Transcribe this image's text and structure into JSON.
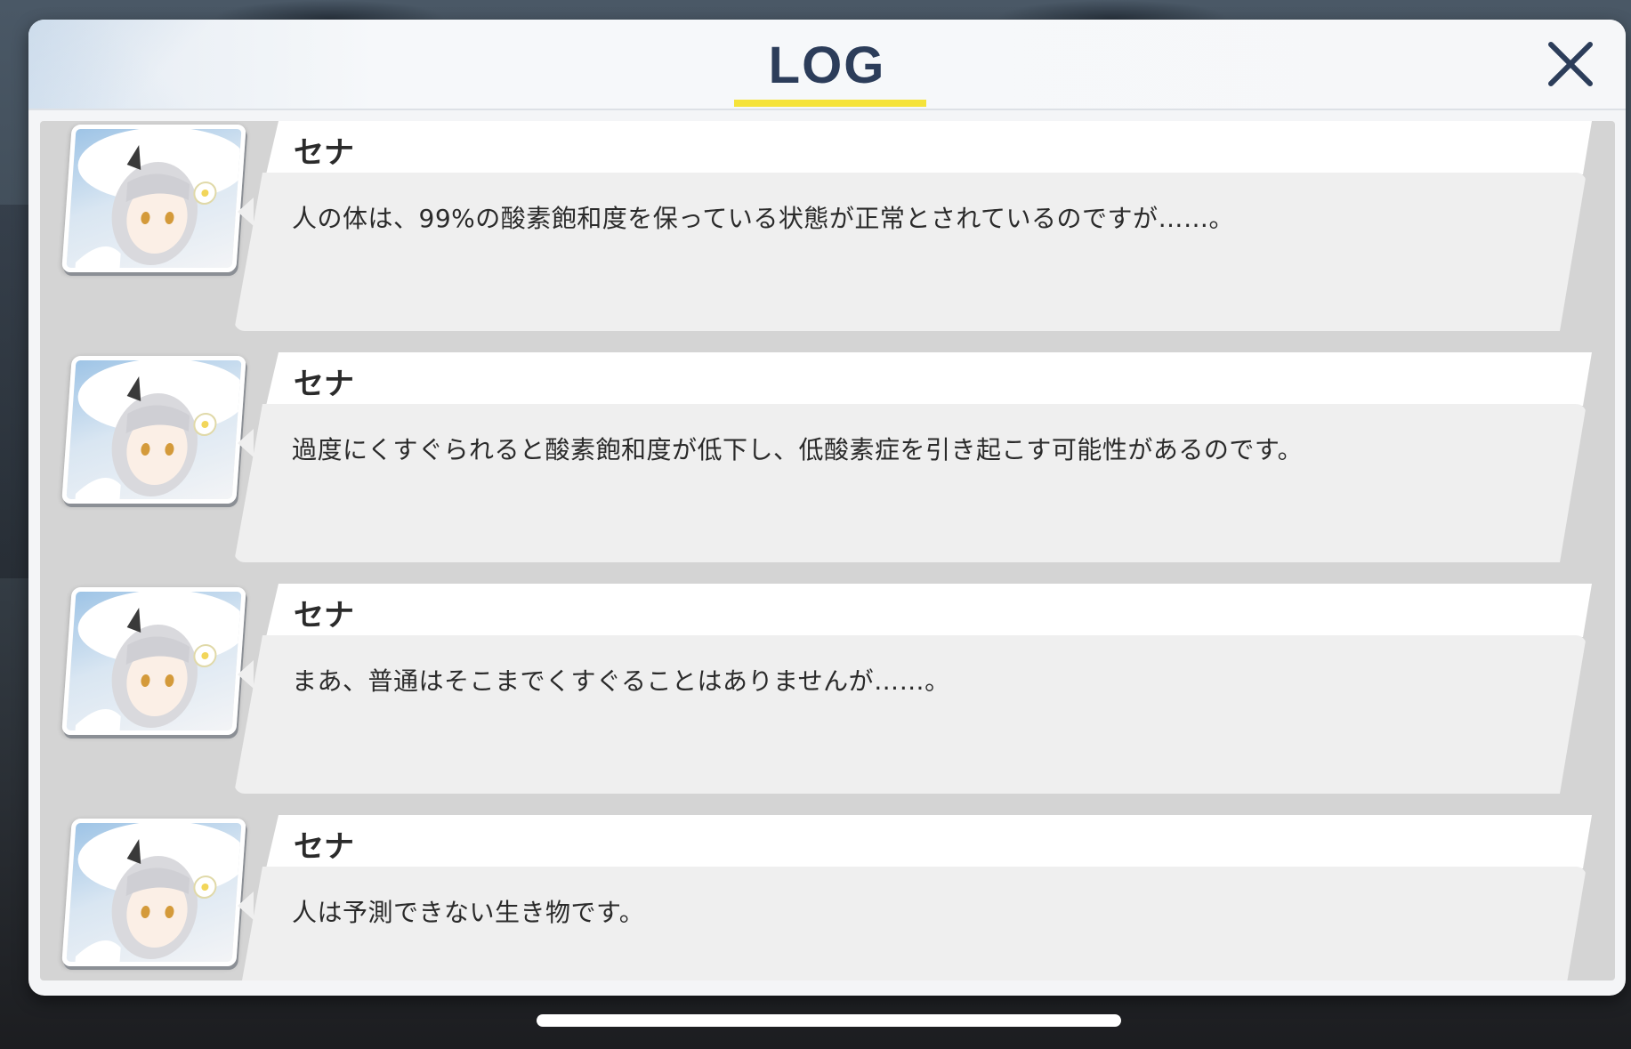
{
  "header": {
    "title": "LOG",
    "close_icon": "close-icon",
    "accent_color": "#f5e33a",
    "title_color": "#2c3d5a"
  },
  "entries": [
    {
      "speaker": "セナ",
      "message": "人の体は、99%の酸素飽和度を保っている状態が正常とされているのですが……。",
      "avatar_icon": "character-portrait"
    },
    {
      "speaker": "セナ",
      "message": "過度にくすぐられると酸素飽和度が低下し、低酸素症を引き起こす可能性があるのです。",
      "avatar_icon": "character-portrait"
    },
    {
      "speaker": "セナ",
      "message": "まあ、普通はそこまでくすぐることはありませんが……。",
      "avatar_icon": "character-portrait"
    },
    {
      "speaker": "セナ",
      "message": "人は予測できない生き物です。",
      "avatar_icon": "character-portrait"
    }
  ]
}
